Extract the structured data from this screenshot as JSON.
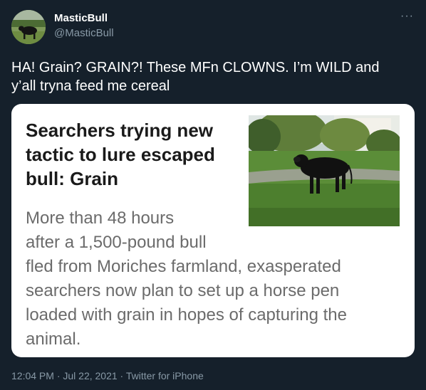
{
  "tweet": {
    "author": {
      "name": "MasticBull",
      "handle": "@MasticBull"
    },
    "more_icon": "more-horizontal-icon",
    "more_glyph": "···",
    "text_lines": [
      "HA! Grain? GRAIN?! These MFn CLOWNS. I’m WILD and",
      "y’all tryna feed me cereal"
    ],
    "card": {
      "headline_lines": [
        "Searchers trying new",
        "tactic to lure escaped",
        "bull: Grain"
      ],
      "summary_lines": [
        "More than 48 hours",
        "after a 1,500-pound bull",
        "fled from Moriches farmland, exasperated",
        "searchers now plan to set up a horse pen",
        "loaded with grain in hopes of capturing the",
        "animal."
      ]
    },
    "meta": "12:04 PM · Jul 22, 2021 · Twitter for iPhone"
  },
  "colors": {
    "background": "#15202b",
    "secondary_text": "#8899a6",
    "card_background": "#ffffff"
  }
}
